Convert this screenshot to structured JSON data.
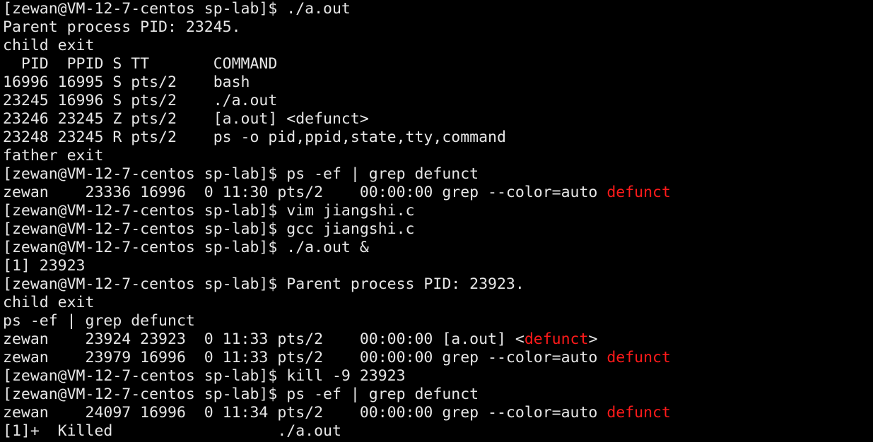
{
  "terminal": {
    "colors": {
      "background": "#000000",
      "foreground": "#e6e6e6",
      "highlight": "#ff1a1a"
    },
    "lines": [
      [
        {
          "t": "[zewan@VM-12-7-centos sp-lab]$ ./a.out"
        }
      ],
      [
        {
          "t": "Parent process PID: 23245."
        }
      ],
      [
        {
          "t": "child exit"
        }
      ],
      [
        {
          "t": "  PID  PPID S TT       COMMAND"
        }
      ],
      [
        {
          "t": "16996 16995 S pts/2    bash"
        }
      ],
      [
        {
          "t": "23245 16996 S pts/2    ./a.out"
        }
      ],
      [
        {
          "t": "23246 23245 Z pts/2    [a.out] <defunct>"
        }
      ],
      [
        {
          "t": "23248 23245 R pts/2    ps -o pid,ppid,state,tty,command"
        }
      ],
      [
        {
          "t": "father exit"
        }
      ],
      [
        {
          "t": "[zewan@VM-12-7-centos sp-lab]$ ps -ef | grep defunct"
        }
      ],
      [
        {
          "t": "zewan    23336 16996  0 11:30 pts/2    00:00:00 grep --color=auto "
        },
        {
          "t": "defunct",
          "hl": true
        }
      ],
      [
        {
          "t": "[zewan@VM-12-7-centos sp-lab]$ vim jiangshi.c"
        }
      ],
      [
        {
          "t": "[zewan@VM-12-7-centos sp-lab]$ gcc jiangshi.c"
        }
      ],
      [
        {
          "t": "[zewan@VM-12-7-centos sp-lab]$ ./a.out &"
        }
      ],
      [
        {
          "t": "[1] 23923"
        }
      ],
      [
        {
          "t": "[zewan@VM-12-7-centos sp-lab]$ Parent process PID: 23923."
        }
      ],
      [
        {
          "t": "child exit"
        }
      ],
      [
        {
          "t": "ps -ef | grep defunct"
        }
      ],
      [
        {
          "t": "zewan    23924 23923  0 11:33 pts/2    00:00:00 [a.out] <"
        },
        {
          "t": "defunct",
          "hl": true
        },
        {
          "t": ">"
        }
      ],
      [
        {
          "t": "zewan    23979 16996  0 11:33 pts/2    00:00:00 grep --color=auto "
        },
        {
          "t": "defunct",
          "hl": true
        }
      ],
      [
        {
          "t": "[zewan@VM-12-7-centos sp-lab]$ kill -9 23923"
        }
      ],
      [
        {
          "t": "[zewan@VM-12-7-centos sp-lab]$ ps -ef | grep defunct"
        }
      ],
      [
        {
          "t": "zewan    24097 16996  0 11:34 pts/2    00:00:00 grep --color=auto "
        },
        {
          "t": "defunct",
          "hl": true
        }
      ],
      [
        {
          "t": "[1]+  Killed                  ./a.out"
        }
      ]
    ]
  }
}
